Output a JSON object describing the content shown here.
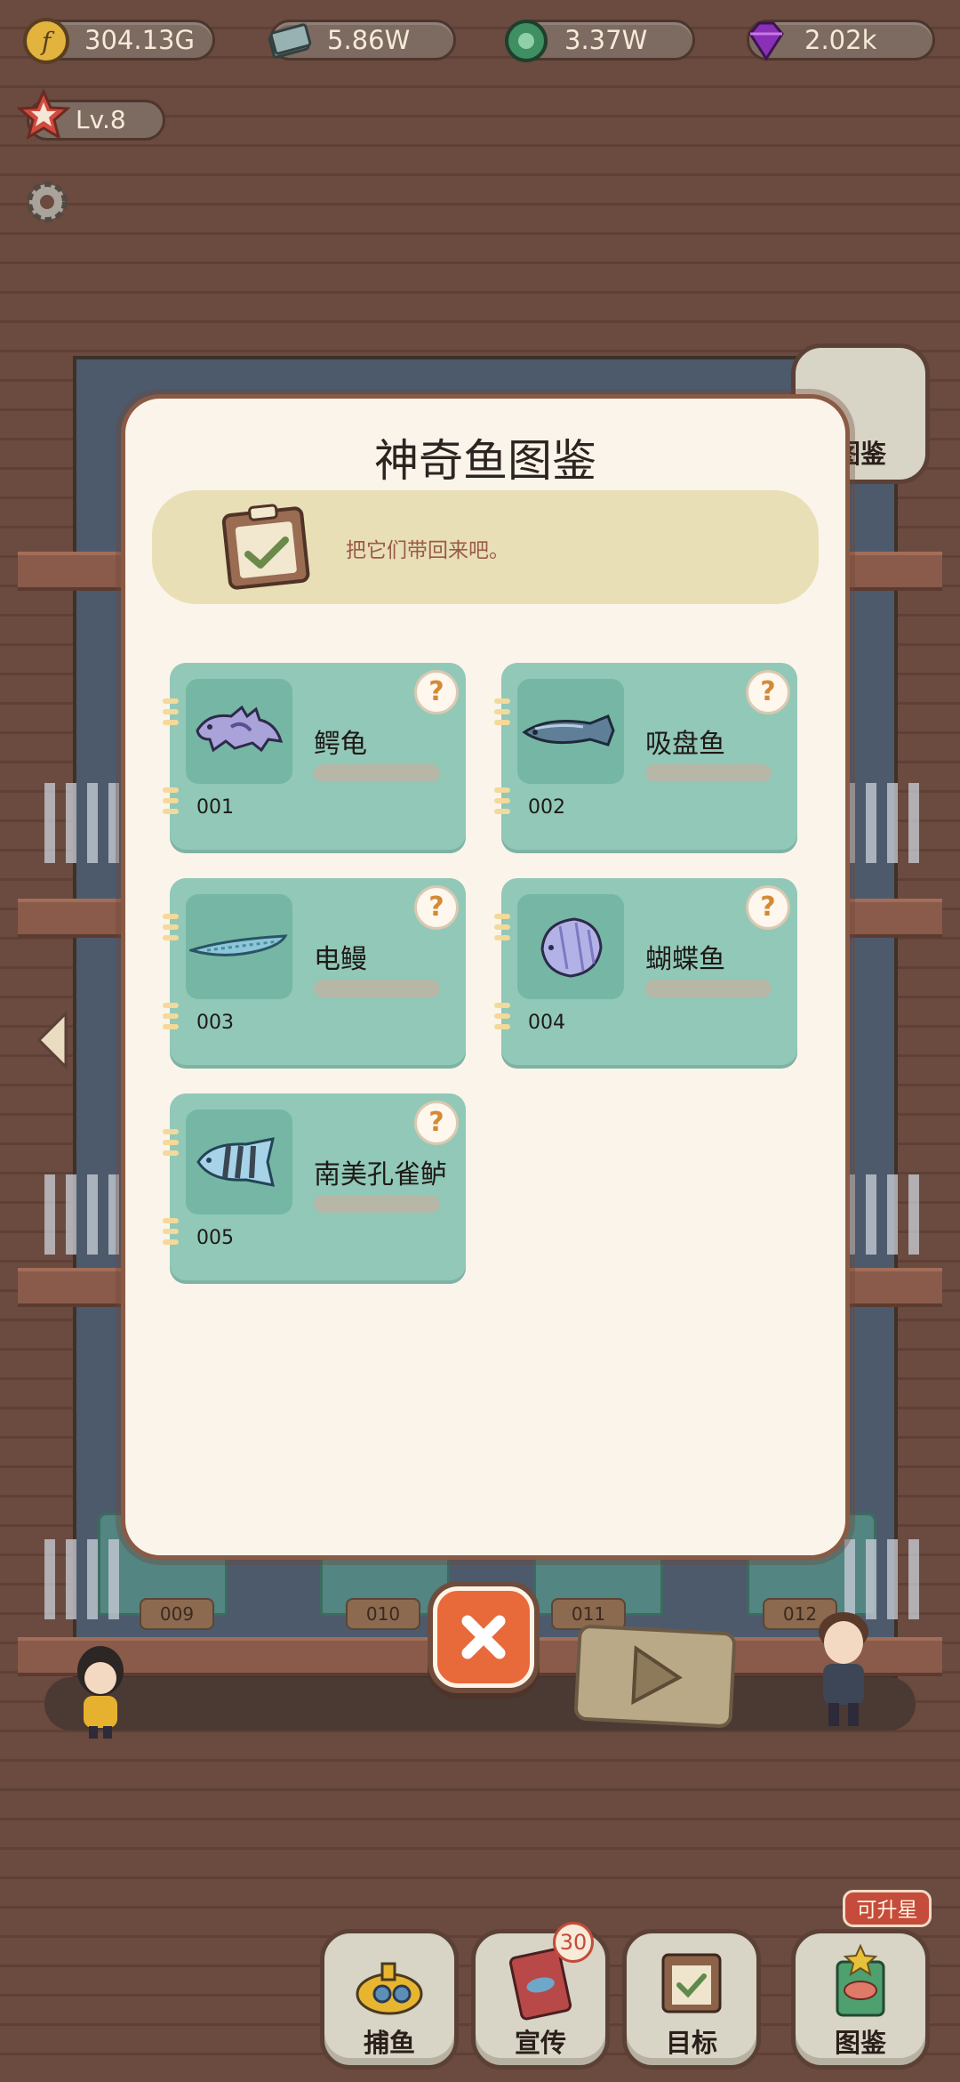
{
  "resources": [
    {
      "name": "coin",
      "value": "304.13G",
      "color": "#d9a83a"
    },
    {
      "name": "notes",
      "value": "5.86W",
      "color": "#6f8a8e"
    },
    {
      "name": "gear-token",
      "value": "3.37W",
      "color": "#3c8a5e"
    },
    {
      "name": "gem",
      "value": "2.02k",
      "color": "#8a2fb8"
    }
  ],
  "level": {
    "label": "Lv.8"
  },
  "side_button": {
    "label": "图鉴"
  },
  "modal": {
    "title": "神奇鱼图鉴",
    "banner_text": "把它们带回来吧。",
    "cards": [
      {
        "number": "001",
        "name": "鳄龟",
        "badge": "?"
      },
      {
        "number": "002",
        "name": "吸盘鱼",
        "badge": "?"
      },
      {
        "number": "003",
        "name": "电鳗",
        "badge": "?"
      },
      {
        "number": "004",
        "name": "蝴蝶鱼",
        "badge": "?"
      },
      {
        "number": "005",
        "name": "南美孔雀鲈",
        "badge": "?"
      }
    ]
  },
  "pot_labels": [
    "009",
    "010",
    "011",
    "012"
  ],
  "bottom_nav": [
    {
      "label": "捕鱼",
      "icon": "submarine-icon"
    },
    {
      "label": "宣传",
      "icon": "flyer-icon",
      "badge": "30"
    },
    {
      "label": "目标",
      "icon": "checklist-icon"
    },
    {
      "label": "图鉴",
      "icon": "fish-book-icon",
      "tag": "可升星"
    }
  ],
  "colors": {
    "card": "#91c8b8",
    "modal_bg": "#fbf4ea",
    "close": "#e86a3a",
    "accent_question": "#d48a35"
  }
}
